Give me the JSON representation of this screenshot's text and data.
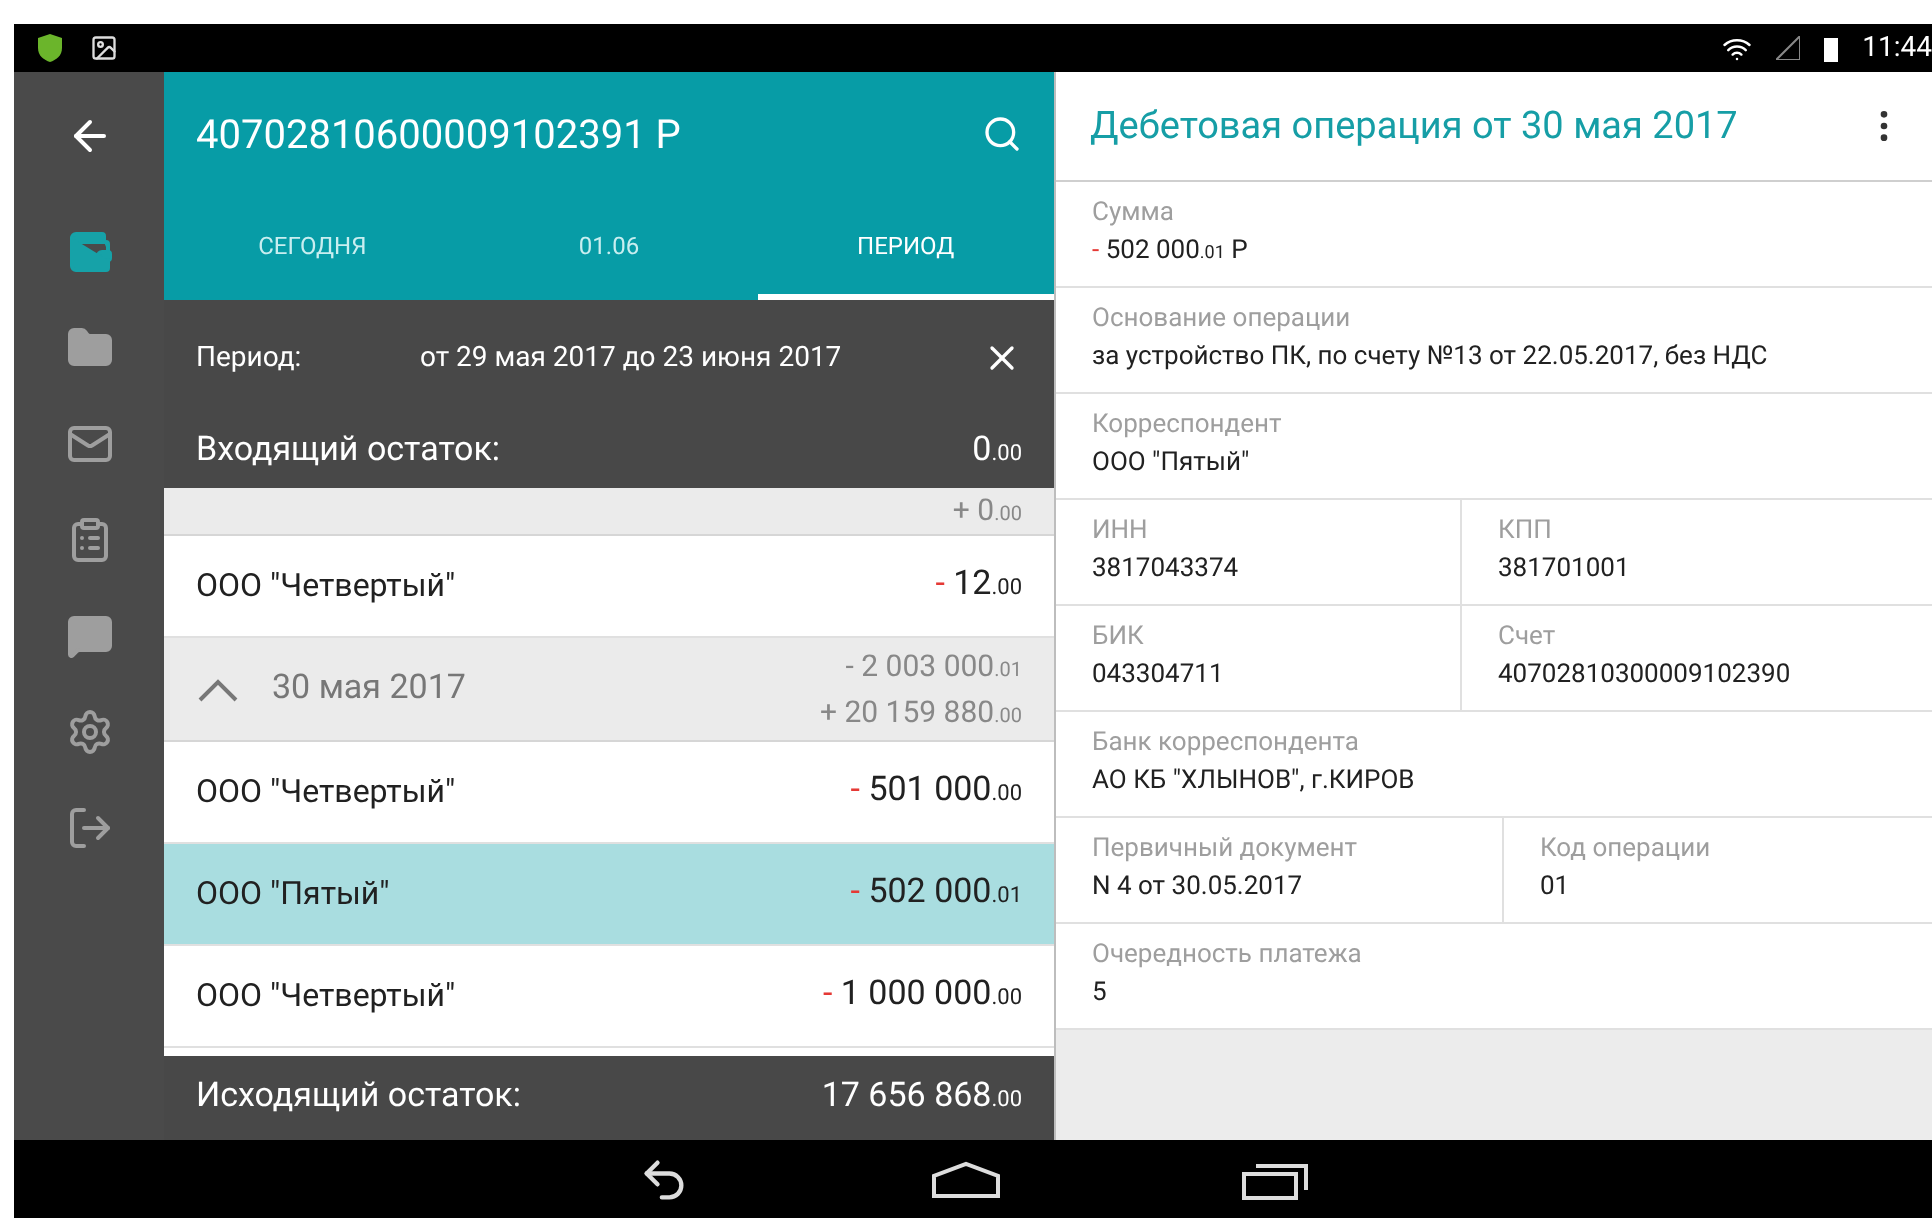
{
  "status_bar": {
    "time": "11:44"
  },
  "rail": [
    {
      "selected": false
    },
    {
      "selected": true
    },
    {
      "selected": false
    },
    {
      "selected": false
    },
    {
      "selected": false
    },
    {
      "selected": false
    },
    {
      "selected": false
    },
    {
      "selected": false
    }
  ],
  "account": {
    "title": "40702810600009102391 Р"
  },
  "tabs": [
    {
      "label": "СЕГОДНЯ",
      "selected": false
    },
    {
      "label": "01.06",
      "selected": false
    },
    {
      "label": "ПЕРИОД",
      "selected": true
    }
  ],
  "period": {
    "label": "Период:",
    "value": "от 29 мая 2017 до 23 июня 2017"
  },
  "opening_balance": {
    "label": "Входящий остаток:",
    "value": "0",
    "cents": ".00"
  },
  "list": [
    {
      "kind": "group",
      "amounts": [
        {
          "sign": "+",
          "value": "0",
          "cents": ".00"
        }
      ]
    },
    {
      "kind": "row",
      "name": "ООО \"Четвертый\"",
      "sign": "-",
      "value": "12",
      "cents": ".00",
      "selected": false
    },
    {
      "kind": "group",
      "title": "30 мая 2017",
      "expanded": true,
      "amounts": [
        {
          "sign": "-",
          "value": "2 003 000",
          "cents": ".01"
        },
        {
          "sign": "+",
          "value": "20 159 880",
          "cents": ".00"
        }
      ]
    },
    {
      "kind": "row",
      "name": "ООО \"Четвертый\"",
      "sign": "-",
      "value": "501 000",
      "cents": ".00",
      "selected": false
    },
    {
      "kind": "row",
      "name": "ООО \"Пятый\"",
      "sign": "-",
      "value": "502 000",
      "cents": ".01",
      "selected": true
    },
    {
      "kind": "row",
      "name": "ООО \"Четвертый\"",
      "sign": "-",
      "value": "1 000 000",
      "cents": ".00",
      "selected": false
    }
  ],
  "closing_balance": {
    "label": "Исходящий остаток:",
    "value": "17 656 868",
    "cents": ".00"
  },
  "detail": {
    "title": "Дебетовая операция от 30 мая 2017",
    "rows": [
      [
        {
          "label": "Сумма",
          "kind": "amount",
          "sign": "-",
          "value": "502 000",
          "cents": ".01",
          "currency": "Р"
        }
      ],
      [
        {
          "label": "Основание операции",
          "kind": "text",
          "value": "за устройство ПК, по счету №13 от 22.05.2017, без НДС"
        }
      ],
      [
        {
          "label": "Корреспондент",
          "kind": "text",
          "value": "ООО \"Пятый\""
        }
      ],
      [
        {
          "label": "ИНН",
          "kind": "text",
          "value": "3817043374"
        },
        {
          "label": "КПП",
          "kind": "text",
          "value": "381701001"
        }
      ],
      [
        {
          "label": "БИК",
          "kind": "text",
          "value": "043304711"
        },
        {
          "label": "Счет",
          "kind": "text",
          "value": "40702810300009102390"
        }
      ],
      [
        {
          "label": "Банк корреспондента",
          "kind": "text",
          "value": "АО КБ \"ХЛЫНОВ\", г.КИРОВ"
        }
      ],
      [
        {
          "label": "Первичный документ",
          "kind": "text",
          "value": "N 4 от 30.05.2017"
        },
        {
          "label": "Код операции",
          "kind": "text",
          "value": "01"
        }
      ],
      [
        {
          "label": "Очередность платежа",
          "kind": "text",
          "value": "5"
        }
      ]
    ]
  }
}
